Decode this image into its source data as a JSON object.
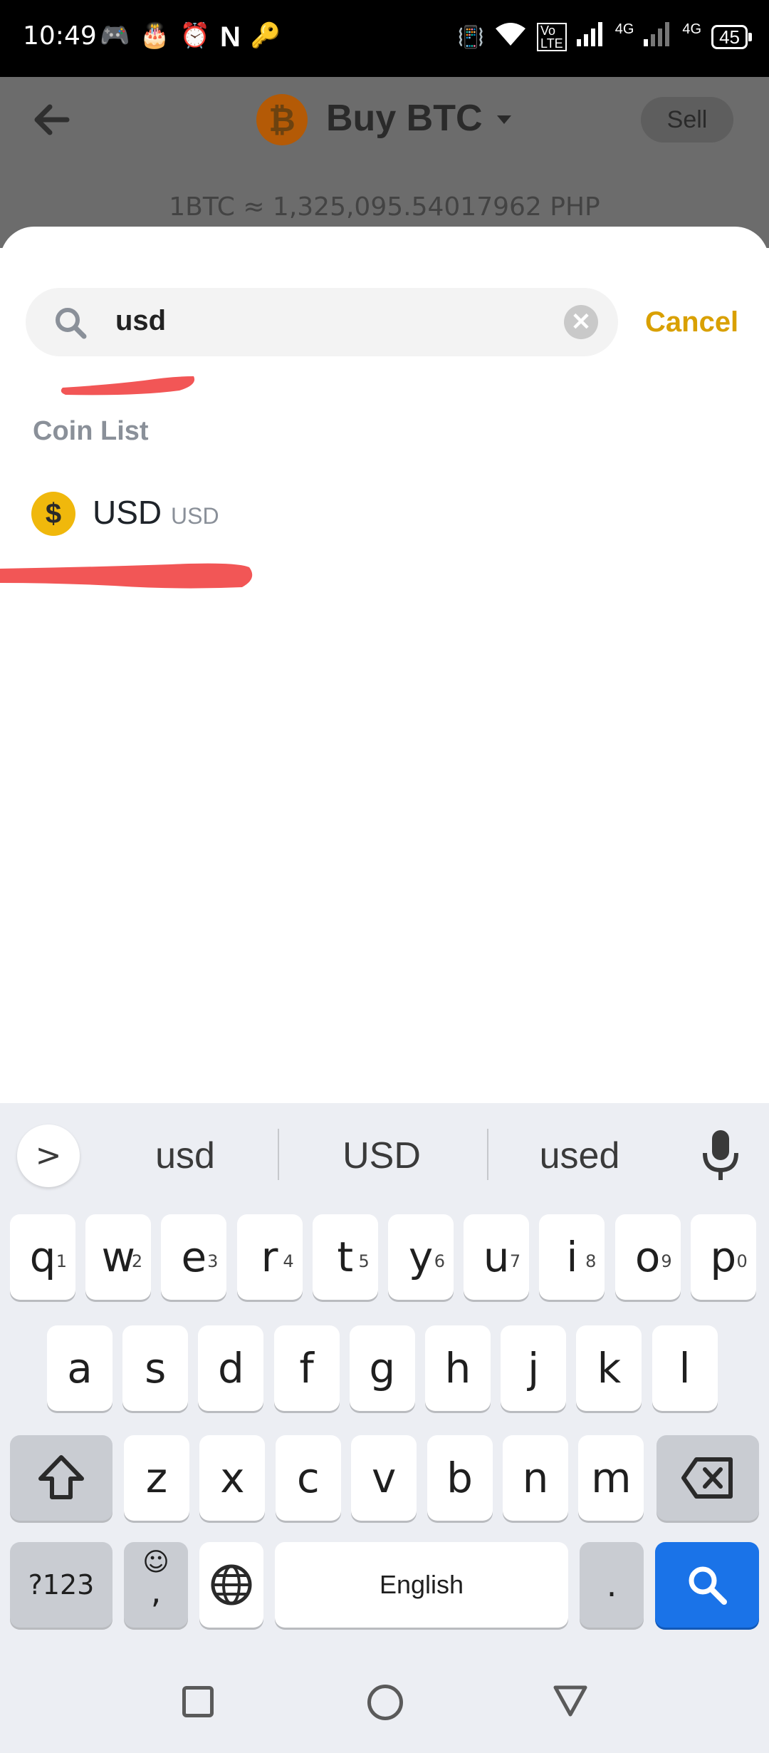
{
  "status_bar": {
    "time": "10:49",
    "battery": "45",
    "network_1": "4G",
    "network_2": "4G"
  },
  "header": {
    "title": "Buy BTC",
    "coin_logo_glyph": "₿",
    "sell_label": "Sell",
    "rate": "1BTC ≈ 1,325,095.54017962 PHP"
  },
  "search": {
    "value": "usd",
    "clear_glyph": "✕",
    "cancel_label": "Cancel"
  },
  "coin_list": {
    "title": "Coin List",
    "items": [
      {
        "name": "USD",
        "symbol": "USD",
        "icon_glyph": "$"
      }
    ]
  },
  "keyboard": {
    "suggestions": [
      "usd",
      "USD",
      "used"
    ],
    "expand_glyph": ">",
    "row1": [
      {
        "k": "q",
        "h": "1"
      },
      {
        "k": "w",
        "h": "2"
      },
      {
        "k": "e",
        "h": "3"
      },
      {
        "k": "r",
        "h": "4"
      },
      {
        "k": "t",
        "h": "5"
      },
      {
        "k": "y",
        "h": "6"
      },
      {
        "k": "u",
        "h": "7"
      },
      {
        "k": "i",
        "h": "8"
      },
      {
        "k": "o",
        "h": "9"
      },
      {
        "k": "p",
        "h": "0"
      }
    ],
    "row2": [
      "a",
      "s",
      "d",
      "f",
      "g",
      "h",
      "j",
      "k",
      "l"
    ],
    "row3": [
      "z",
      "x",
      "c",
      "v",
      "b",
      "n",
      "m"
    ],
    "symbols_label": "?123",
    "emoji_glyph": "☺",
    "comma_label": ",",
    "space_label": "English",
    "period_label": "."
  },
  "colors": {
    "accent": "#d9a000",
    "search_key": "#1a73e8",
    "scribble": "#f25656"
  }
}
